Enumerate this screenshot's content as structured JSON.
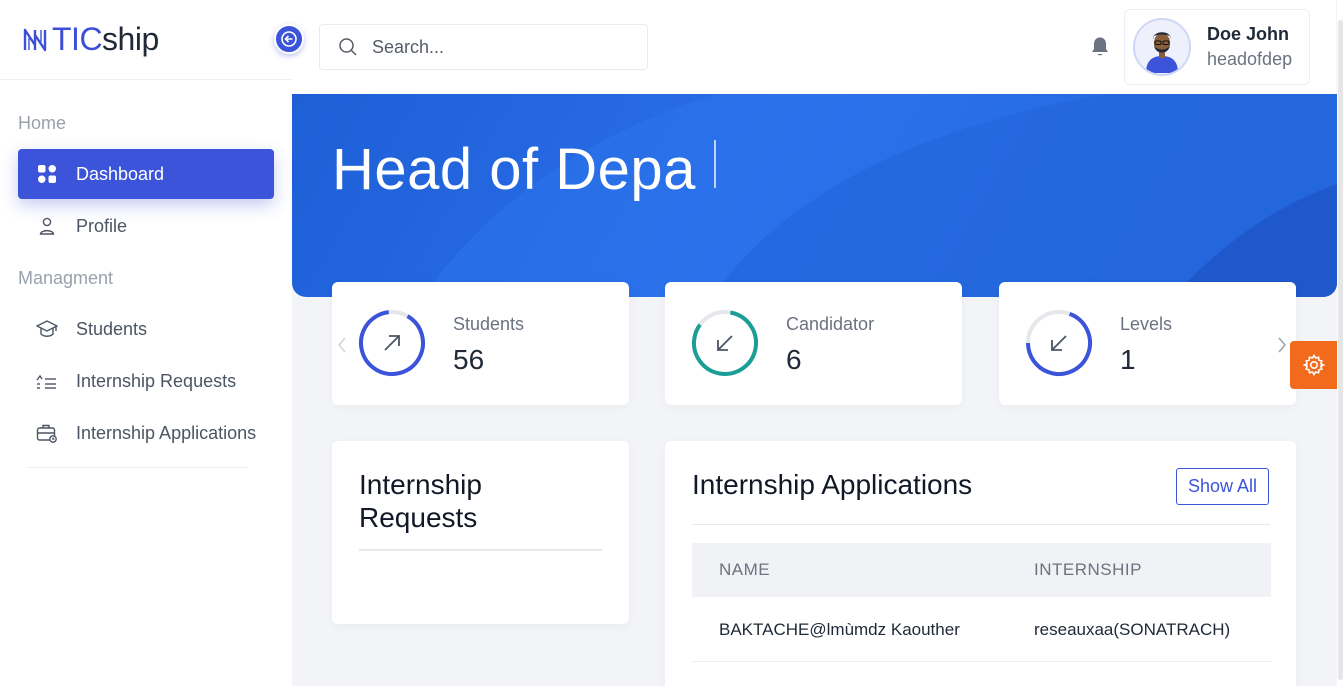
{
  "brand": {
    "tic": "TIC",
    "ship": "ship",
    "logo_icon": "n-logo-icon"
  },
  "sidebar": {
    "section_home": "Home",
    "section_management": "Managment",
    "items": [
      {
        "label": "Dashboard",
        "icon": "grid-icon",
        "active": true
      },
      {
        "label": "Profile",
        "icon": "user-icon"
      },
      {
        "label": "Students",
        "icon": "graduation-cap-icon"
      },
      {
        "label": "Internship Requests",
        "icon": "list-icon"
      },
      {
        "label": "Internship Applications",
        "icon": "briefcase-icon"
      }
    ]
  },
  "search": {
    "placeholder": "Search..."
  },
  "user": {
    "name": "Doe John",
    "role": "headofdep"
  },
  "hero": {
    "title": "Head of Depa"
  },
  "stats": [
    {
      "label": "Students",
      "value": "56",
      "icon": "arrow-up-right-icon",
      "color": "#3b54d9"
    },
    {
      "label": "Candidator",
      "value": "6",
      "icon": "arrow-down-left-icon",
      "color": "#1a9e96"
    },
    {
      "label": "Levels",
      "value": "1",
      "icon": "arrow-down-left-icon",
      "color": "#3b54d9"
    }
  ],
  "requests_panel": {
    "title": "Internship Requests"
  },
  "applications_panel": {
    "title": "Internship Applications",
    "show_all": "Show All",
    "columns": [
      "NAME",
      "INTERNSHIP"
    ],
    "rows": [
      {
        "name": "BAKTACHE@lmùmdz Kaouther",
        "internship": "reseauxaa(SONATRACH)"
      }
    ]
  },
  "colors": {
    "primary": "#3b54d9",
    "hero": "#1e5fd6",
    "settings_tab": "#f26b1d"
  }
}
